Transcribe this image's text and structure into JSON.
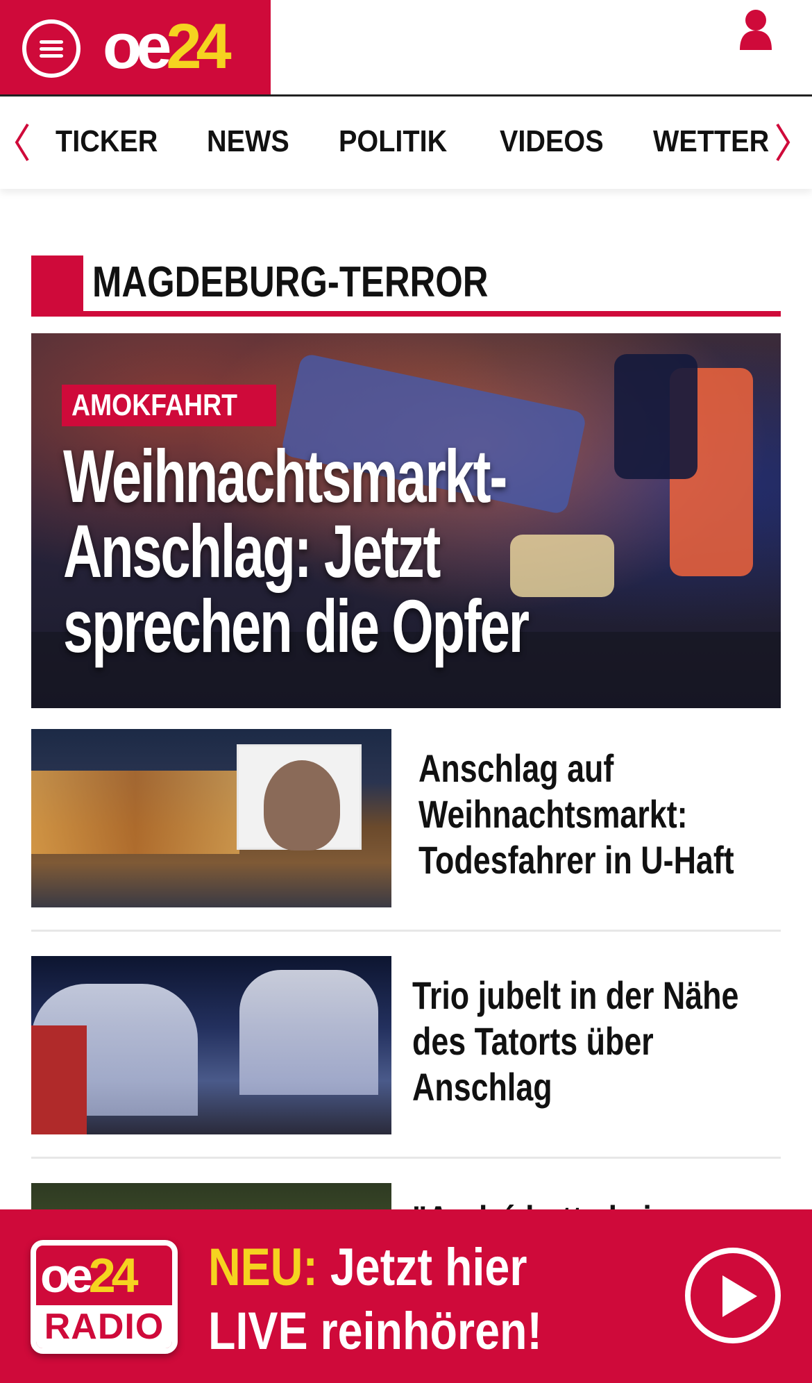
{
  "header": {
    "logo_oe": "oe",
    "logo_num": "24",
    "menu_icon": "hamburger-menu-icon",
    "user_icon": "user-icon",
    "brand_color": "#cf0a3a",
    "accent_color": "#f5d320"
  },
  "nav": {
    "items": [
      "TICKER",
      "NEWS",
      "POLITIK",
      "VIDEOS",
      "WETTER"
    ],
    "left_icon": "chevron-left-icon",
    "right_icon": "chevron-right-icon"
  },
  "section": {
    "title": "MAGDEBURG-TERROR"
  },
  "hero": {
    "kicker": "AMOKFAHRT",
    "title_line1": "Weihnachtsmarkt-",
    "title_line2": "Anschlag: Jetzt",
    "title_line3": "sprechen die Opfer"
  },
  "articles": [
    {
      "title_lines": [
        "Anschlag auf",
        "Weihnachtsmarkt:",
        "Todesfahrer in U-Haft"
      ]
    },
    {
      "title_lines": [
        "Trio jubelt in der Nähe",
        "des Tatorts über",
        "Anschlag"
      ]
    },
    {
      "title_lines": [
        "\"André hatte keine"
      ]
    }
  ],
  "radio": {
    "logo_oe": "oe",
    "logo_num": "24",
    "logo_label": "RADIO",
    "neu": "NEU:",
    "line1_rest": " Jetzt hier",
    "line2": "LIVE reinhören!",
    "play_icon": "play-icon"
  }
}
